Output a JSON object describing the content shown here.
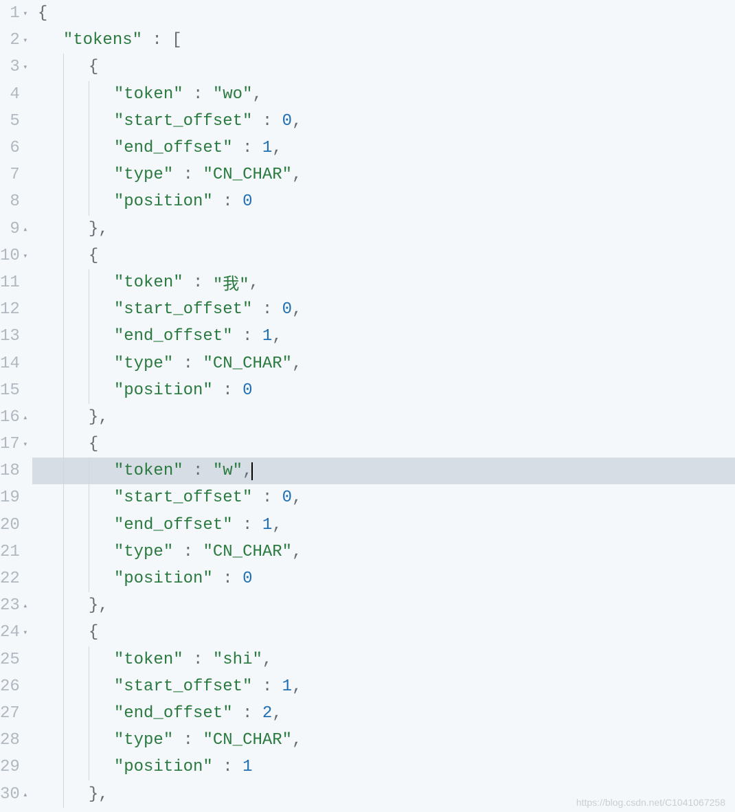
{
  "watermark": "https://blog.csdn.net/C1041067258",
  "gutter": {
    "fold_collapsed_glyph": "▸",
    "fold_expanded_glyph": "▾",
    "fold_collapse_up_glyph": "▴"
  },
  "active_line_index": 17,
  "code": {
    "tokens_key": "\"tokens\"",
    "colon_bracket": " : [",
    "open_brace": "{",
    "comma": ",",
    "close_brace_comma": "},",
    "token_key": "\"token\"",
    "start_offset_key": "\"start_offset\"",
    "end_offset_key": "\"end_offset\"",
    "type_key": "\"type\"",
    "position_key": "\"position\"",
    "sep": " : ",
    "items": [
      {
        "token": "\"wo\"",
        "start_offset": "0",
        "end_offset": "1",
        "type": "\"CN_CHAR\"",
        "position": "0"
      },
      {
        "token": "\"我\"",
        "start_offset": "0",
        "end_offset": "1",
        "type": "\"CN_CHAR\"",
        "position": "0"
      },
      {
        "token": "\"w\"",
        "start_offset": "0",
        "end_offset": "1",
        "type": "\"CN_CHAR\"",
        "position": "0"
      },
      {
        "token": "\"shi\"",
        "start_offset": "1",
        "end_offset": "2",
        "type": "\"CN_CHAR\"",
        "position": "1"
      }
    ]
  },
  "lines": [
    {
      "n": "1",
      "fold": "expanded",
      "indent": 0,
      "parts": [
        {
          "cls": "pun",
          "k": "code.open_brace"
        }
      ]
    },
    {
      "n": "2",
      "fold": "expanded",
      "indent": 1,
      "parts": [
        {
          "cls": "key",
          "k": "code.tokens_key"
        },
        {
          "cls": "pun",
          "k": "code.colon_bracket"
        }
      ]
    },
    {
      "n": "3",
      "fold": "expanded",
      "indent": 2,
      "parts": [
        {
          "cls": "pun",
          "k": "code.open_brace"
        }
      ]
    },
    {
      "n": "4",
      "fold": null,
      "indent": 3,
      "parts": [
        {
          "cls": "key",
          "k": "code.token_key"
        },
        {
          "cls": "pun",
          "k": "code.sep"
        },
        {
          "cls": "str",
          "k": "code.items.0.token"
        },
        {
          "cls": "pun",
          "k": "code.comma"
        }
      ]
    },
    {
      "n": "5",
      "fold": null,
      "indent": 3,
      "parts": [
        {
          "cls": "key",
          "k": "code.start_offset_key"
        },
        {
          "cls": "pun",
          "k": "code.sep"
        },
        {
          "cls": "num",
          "k": "code.items.0.start_offset"
        },
        {
          "cls": "pun",
          "k": "code.comma"
        }
      ]
    },
    {
      "n": "6",
      "fold": null,
      "indent": 3,
      "parts": [
        {
          "cls": "key",
          "k": "code.end_offset_key"
        },
        {
          "cls": "pun",
          "k": "code.sep"
        },
        {
          "cls": "num",
          "k": "code.items.0.end_offset"
        },
        {
          "cls": "pun",
          "k": "code.comma"
        }
      ]
    },
    {
      "n": "7",
      "fold": null,
      "indent": 3,
      "parts": [
        {
          "cls": "key",
          "k": "code.type_key"
        },
        {
          "cls": "pun",
          "k": "code.sep"
        },
        {
          "cls": "str",
          "k": "code.items.0.type"
        },
        {
          "cls": "pun",
          "k": "code.comma"
        }
      ]
    },
    {
      "n": "8",
      "fold": null,
      "indent": 3,
      "parts": [
        {
          "cls": "key",
          "k": "code.position_key"
        },
        {
          "cls": "pun",
          "k": "code.sep"
        },
        {
          "cls": "num",
          "k": "code.items.0.position"
        }
      ]
    },
    {
      "n": "9",
      "fold": "up",
      "indent": 2,
      "parts": [
        {
          "cls": "pun",
          "k": "code.close_brace_comma"
        }
      ]
    },
    {
      "n": "10",
      "fold": "expanded",
      "indent": 2,
      "parts": [
        {
          "cls": "pun",
          "k": "code.open_brace"
        }
      ]
    },
    {
      "n": "11",
      "fold": null,
      "indent": 3,
      "parts": [
        {
          "cls": "key",
          "k": "code.token_key"
        },
        {
          "cls": "pun",
          "k": "code.sep"
        },
        {
          "cls": "str",
          "k": "code.items.1.token"
        },
        {
          "cls": "pun",
          "k": "code.comma"
        }
      ]
    },
    {
      "n": "12",
      "fold": null,
      "indent": 3,
      "parts": [
        {
          "cls": "key",
          "k": "code.start_offset_key"
        },
        {
          "cls": "pun",
          "k": "code.sep"
        },
        {
          "cls": "num",
          "k": "code.items.1.start_offset"
        },
        {
          "cls": "pun",
          "k": "code.comma"
        }
      ]
    },
    {
      "n": "13",
      "fold": null,
      "indent": 3,
      "parts": [
        {
          "cls": "key",
          "k": "code.end_offset_key"
        },
        {
          "cls": "pun",
          "k": "code.sep"
        },
        {
          "cls": "num",
          "k": "code.items.1.end_offset"
        },
        {
          "cls": "pun",
          "k": "code.comma"
        }
      ]
    },
    {
      "n": "14",
      "fold": null,
      "indent": 3,
      "parts": [
        {
          "cls": "key",
          "k": "code.type_key"
        },
        {
          "cls": "pun",
          "k": "code.sep"
        },
        {
          "cls": "str",
          "k": "code.items.1.type"
        },
        {
          "cls": "pun",
          "k": "code.comma"
        }
      ]
    },
    {
      "n": "15",
      "fold": null,
      "indent": 3,
      "parts": [
        {
          "cls": "key",
          "k": "code.position_key"
        },
        {
          "cls": "pun",
          "k": "code.sep"
        },
        {
          "cls": "num",
          "k": "code.items.1.position"
        }
      ]
    },
    {
      "n": "16",
      "fold": "up",
      "indent": 2,
      "parts": [
        {
          "cls": "pun",
          "k": "code.close_brace_comma"
        }
      ]
    },
    {
      "n": "17",
      "fold": "expanded",
      "indent": 2,
      "parts": [
        {
          "cls": "pun",
          "k": "code.open_brace"
        }
      ]
    },
    {
      "n": "18",
      "fold": null,
      "indent": 3,
      "active": true,
      "cursor": true,
      "parts": [
        {
          "cls": "key",
          "k": "code.token_key"
        },
        {
          "cls": "pun",
          "k": "code.sep"
        },
        {
          "cls": "str",
          "k": "code.items.2.token"
        },
        {
          "cls": "pun",
          "k": "code.comma"
        }
      ]
    },
    {
      "n": "19",
      "fold": null,
      "indent": 3,
      "parts": [
        {
          "cls": "key",
          "k": "code.start_offset_key"
        },
        {
          "cls": "pun",
          "k": "code.sep"
        },
        {
          "cls": "num",
          "k": "code.items.2.start_offset"
        },
        {
          "cls": "pun",
          "k": "code.comma"
        }
      ]
    },
    {
      "n": "20",
      "fold": null,
      "indent": 3,
      "parts": [
        {
          "cls": "key",
          "k": "code.end_offset_key"
        },
        {
          "cls": "pun",
          "k": "code.sep"
        },
        {
          "cls": "num",
          "k": "code.items.2.end_offset"
        },
        {
          "cls": "pun",
          "k": "code.comma"
        }
      ]
    },
    {
      "n": "21",
      "fold": null,
      "indent": 3,
      "parts": [
        {
          "cls": "key",
          "k": "code.type_key"
        },
        {
          "cls": "pun",
          "k": "code.sep"
        },
        {
          "cls": "str",
          "k": "code.items.2.type"
        },
        {
          "cls": "pun",
          "k": "code.comma"
        }
      ]
    },
    {
      "n": "22",
      "fold": null,
      "indent": 3,
      "parts": [
        {
          "cls": "key",
          "k": "code.position_key"
        },
        {
          "cls": "pun",
          "k": "code.sep"
        },
        {
          "cls": "num",
          "k": "code.items.2.position"
        }
      ]
    },
    {
      "n": "23",
      "fold": "up",
      "indent": 2,
      "parts": [
        {
          "cls": "pun",
          "k": "code.close_brace_comma"
        }
      ]
    },
    {
      "n": "24",
      "fold": "expanded",
      "indent": 2,
      "parts": [
        {
          "cls": "pun",
          "k": "code.open_brace"
        }
      ]
    },
    {
      "n": "25",
      "fold": null,
      "indent": 3,
      "parts": [
        {
          "cls": "key",
          "k": "code.token_key"
        },
        {
          "cls": "pun",
          "k": "code.sep"
        },
        {
          "cls": "str",
          "k": "code.items.3.token"
        },
        {
          "cls": "pun",
          "k": "code.comma"
        }
      ]
    },
    {
      "n": "26",
      "fold": null,
      "indent": 3,
      "parts": [
        {
          "cls": "key",
          "k": "code.start_offset_key"
        },
        {
          "cls": "pun",
          "k": "code.sep"
        },
        {
          "cls": "num",
          "k": "code.items.3.start_offset"
        },
        {
          "cls": "pun",
          "k": "code.comma"
        }
      ]
    },
    {
      "n": "27",
      "fold": null,
      "indent": 3,
      "parts": [
        {
          "cls": "key",
          "k": "code.end_offset_key"
        },
        {
          "cls": "pun",
          "k": "code.sep"
        },
        {
          "cls": "num",
          "k": "code.items.3.end_offset"
        },
        {
          "cls": "pun",
          "k": "code.comma"
        }
      ]
    },
    {
      "n": "28",
      "fold": null,
      "indent": 3,
      "parts": [
        {
          "cls": "key",
          "k": "code.type_key"
        },
        {
          "cls": "pun",
          "k": "code.sep"
        },
        {
          "cls": "str",
          "k": "code.items.3.type"
        },
        {
          "cls": "pun",
          "k": "code.comma"
        }
      ]
    },
    {
      "n": "29",
      "fold": null,
      "indent": 3,
      "parts": [
        {
          "cls": "key",
          "k": "code.position_key"
        },
        {
          "cls": "pun",
          "k": "code.sep"
        },
        {
          "cls": "num",
          "k": "code.items.3.position"
        }
      ]
    },
    {
      "n": "30",
      "fold": "up",
      "indent": 2,
      "parts": [
        {
          "cls": "pun",
          "k": "code.close_brace_comma"
        }
      ]
    }
  ]
}
